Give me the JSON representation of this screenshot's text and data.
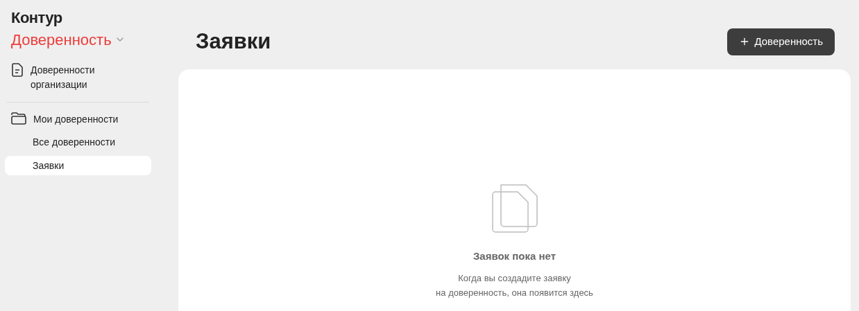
{
  "brand": {
    "logo": "Контур",
    "product": "Доверенность"
  },
  "sidebar": {
    "items": [
      {
        "label": "Доверенности организации",
        "selected": false
      },
      {
        "label": "Мои доверенности",
        "selected": false,
        "children": [
          {
            "label": "Все доверенности",
            "selected": false
          },
          {
            "label": "Заявки",
            "selected": true
          }
        ]
      }
    ]
  },
  "page": {
    "title": "Заявки",
    "action_button": "Доверенность"
  },
  "empty_state": {
    "title": "Заявок пока нет",
    "lines": [
      "Когда вы создадите заявку",
      "на доверенность, она появится здесь"
    ]
  }
}
